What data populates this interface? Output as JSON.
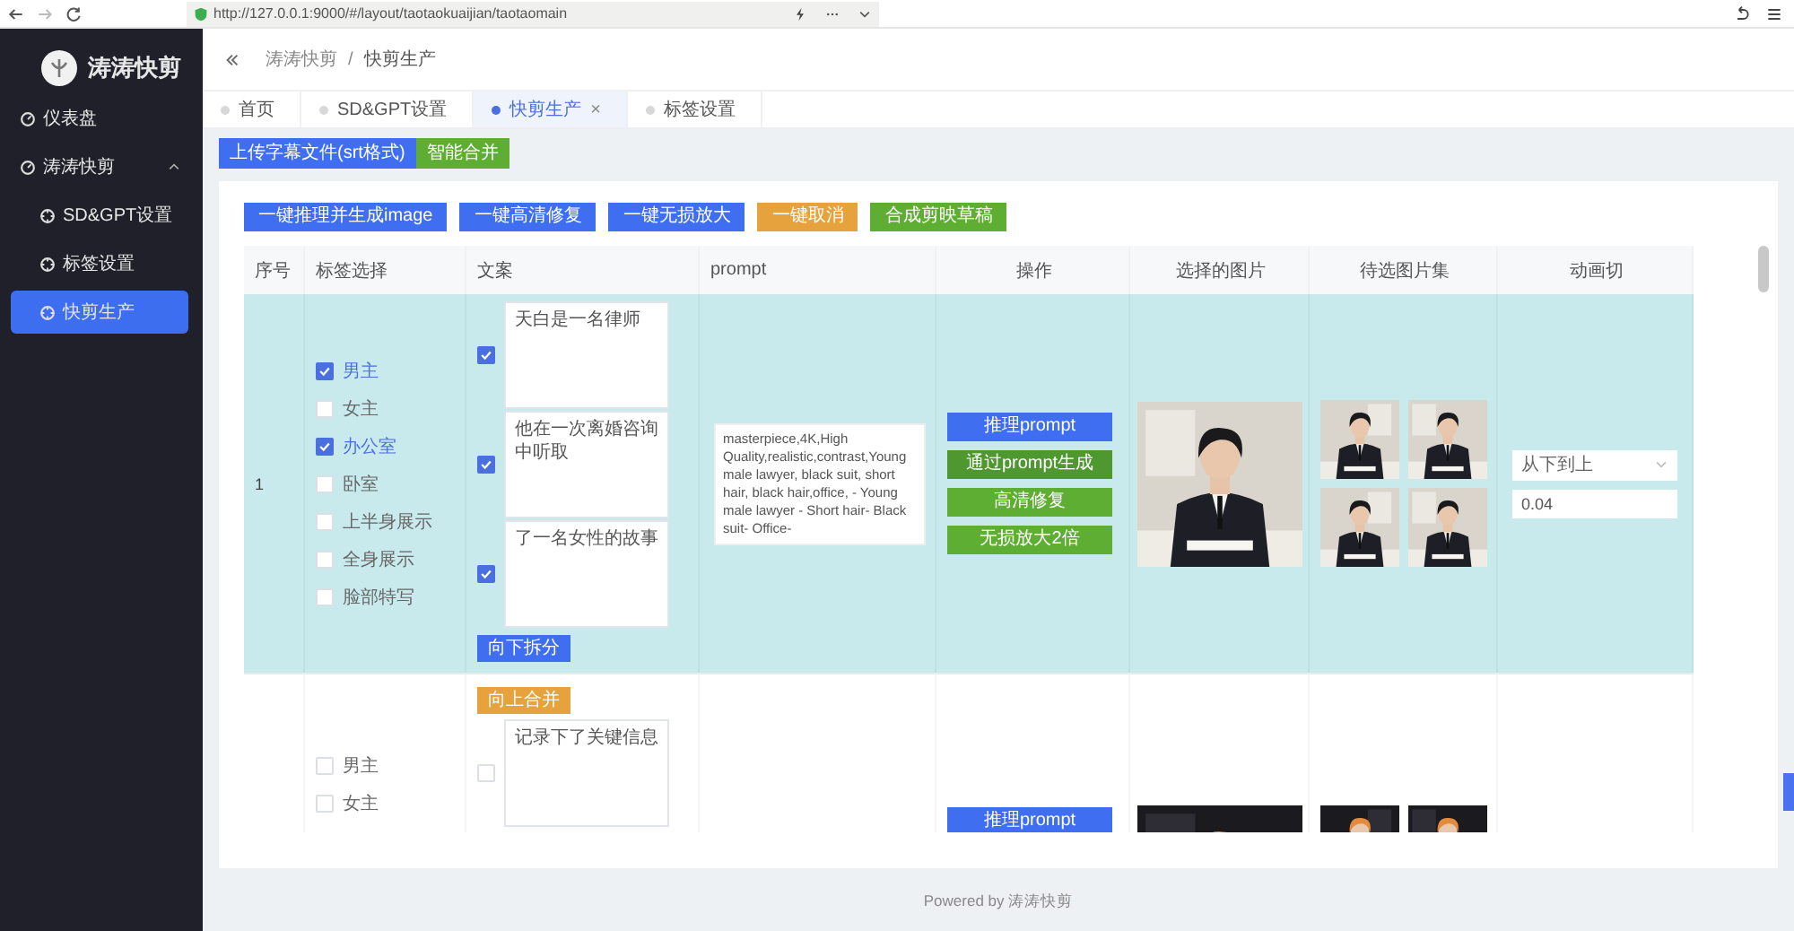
{
  "browser": {
    "url": "http://127.0.0.1:9000/#/layout/taotaokuaijian/taotaomain"
  },
  "sidebar": {
    "logo": "涛涛快剪",
    "items": [
      {
        "label": "仪表盘",
        "selected": false
      },
      {
        "label": "涛涛快剪",
        "selected": false,
        "expanded": true,
        "children": [
          {
            "label": "SD&GPT设置",
            "selected": false
          },
          {
            "label": "标签设置",
            "selected": false
          },
          {
            "label": "快剪生产",
            "selected": true
          }
        ]
      }
    ]
  },
  "breadcrumb": {
    "separator": "/",
    "items": [
      "涛涛快剪",
      "快剪生产"
    ]
  },
  "tabs": [
    {
      "label": "首页",
      "selected": false
    },
    {
      "label": "SD&GPT设置",
      "selected": false
    },
    {
      "label": "快剪生产",
      "selected": true,
      "close": "×"
    },
    {
      "label": "标签设置",
      "selected": false
    }
  ],
  "upload_buttons": [
    {
      "label": "上传字幕文件(srt格式)",
      "kind": "primary"
    },
    {
      "label": "智能合并",
      "kind": "success"
    }
  ],
  "toolbar": [
    {
      "label": "一键推理并生成image",
      "kind": "primary"
    },
    {
      "label": "一键高清修复",
      "kind": "primary"
    },
    {
      "label": "一键无损放大",
      "kind": "primary"
    },
    {
      "label": "一键取消",
      "kind": "warning"
    },
    {
      "label": "合成剪映草稿",
      "kind": "success"
    }
  ],
  "table": {
    "columns": [
      "序号",
      "标签选择",
      "文案",
      "prompt",
      "操作",
      "选择的图片",
      "待选图片集",
      "动画切"
    ],
    "rows": [
      {
        "index": "1",
        "selected": true,
        "tags": [
          {
            "label": "男主",
            "checked": true
          },
          {
            "label": "女主",
            "checked": false
          },
          {
            "label": "办公室",
            "checked": true
          },
          {
            "label": "卧室",
            "checked": false
          },
          {
            "label": "上半身展示",
            "checked": false
          },
          {
            "label": "全身展示",
            "checked": false
          },
          {
            "label": "脸部特写",
            "checked": false
          }
        ],
        "segments": [
          {
            "text": "天白是一名律师",
            "checked": true
          },
          {
            "text": "他在一次离婚咨询中听取",
            "checked": true
          },
          {
            "text": "了一名女性的故事",
            "checked": true
          }
        ],
        "split_button": "向下拆分",
        "prompt": "masterpiece,4K,High Quality,realistic,contrast,Young male lawyer, black suit, short hair, black hair,office, - Young male lawyer - Short hair- Black suit- Office-",
        "actions": [
          {
            "label": "推理prompt",
            "kind": "primary"
          },
          {
            "label": "通过prompt生成",
            "kind": "success-dark"
          },
          {
            "label": "高清修复",
            "kind": "success"
          },
          {
            "label": "无损放大2倍",
            "kind": "success"
          }
        ],
        "selected_picture": {
          "kind": "picture"
        },
        "candidates": [
          {
            "kind": "picture"
          },
          {
            "kind": "picture"
          },
          {
            "kind": "picture"
          },
          {
            "kind": "picture"
          }
        ],
        "direction": "从下到上",
        "speed": "0.04"
      },
      {
        "selected": false,
        "merge_button": "向上合并",
        "tags": [
          {
            "label": "男主",
            "checked": false
          },
          {
            "label": "女主",
            "checked": false
          }
        ],
        "segments": [
          {
            "text": "记录下了关键信息",
            "checked": false
          }
        ],
        "actions": [
          {
            "label": "推理prompt",
            "kind": "primary"
          }
        ],
        "selected_picture": {
          "kind": "picture"
        },
        "candidates": [
          {
            "kind": "picture"
          },
          {
            "kind": "picture"
          }
        ]
      }
    ]
  },
  "footer": "Powered by 涛涛快剪"
}
